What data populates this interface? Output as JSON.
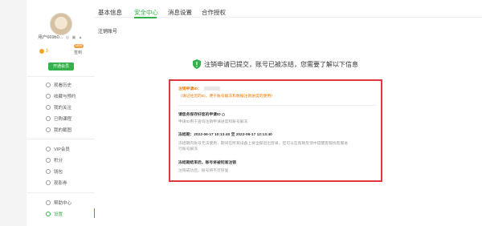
{
  "sidebar": {
    "username": "用户669b0...",
    "user_icons": "◎ ▣ ▲",
    "score_label": "3",
    "badge_new": "NEW",
    "checkin_label": "签到",
    "vip_button": "开通会员",
    "items": [
      {
        "label": "观看历史",
        "icon": "history-icon"
      },
      {
        "label": "收藏与预约",
        "icon": "star-icon"
      },
      {
        "label": "我的关注",
        "icon": "follow-icon"
      },
      {
        "label": "已购课程",
        "icon": "course-icon"
      },
      {
        "label": "我的截图",
        "icon": "screenshot-icon"
      },
      {
        "label": "VIP会员",
        "icon": "vip-icon"
      },
      {
        "label": "积分",
        "icon": "points-icon"
      },
      {
        "label": "钱包",
        "icon": "wallet-icon"
      },
      {
        "label": "观影券",
        "icon": "ticket-icon"
      },
      {
        "label": "帮助中心",
        "icon": "help-icon"
      },
      {
        "label": "设置",
        "icon": "settings-icon"
      }
    ]
  },
  "tabs": [
    "基本信息",
    "安全中心",
    "消息设置",
    "合作授权"
  ],
  "active_tab": "安全中心",
  "subtitle": "注销账号",
  "headline": "注销申请已提交，账号已被冻结，您需要了解以下信息",
  "box": {
    "s1_title": "注销申请ID：",
    "s1_warn": "（请记住您的ID，便于账号解冻和数据注销进度的使用）",
    "s2_title": "请您务保存好您的申请ID",
    "s2_desc": "申请ID用于查询注销申请进度和账号解冻",
    "s3_title": "冻结期：2022-06-17 10:13:40 至 2022-06-17 12:13:40",
    "s3_desc1": "冻结期内账号无法使用，期间在所有设备上将全部退出登录，您可以在帮助反馈中提醒客服找客服进",
    "s3_desc2": "行账号解冻",
    "s4_title": "冻结期结束后，账号将被彻底注销",
    "s4_desc": "注销成功后，账号将不可恢复"
  },
  "colors": {
    "accent": "#36b04a",
    "alert": "#e0373a",
    "warn": "#f07a00"
  }
}
